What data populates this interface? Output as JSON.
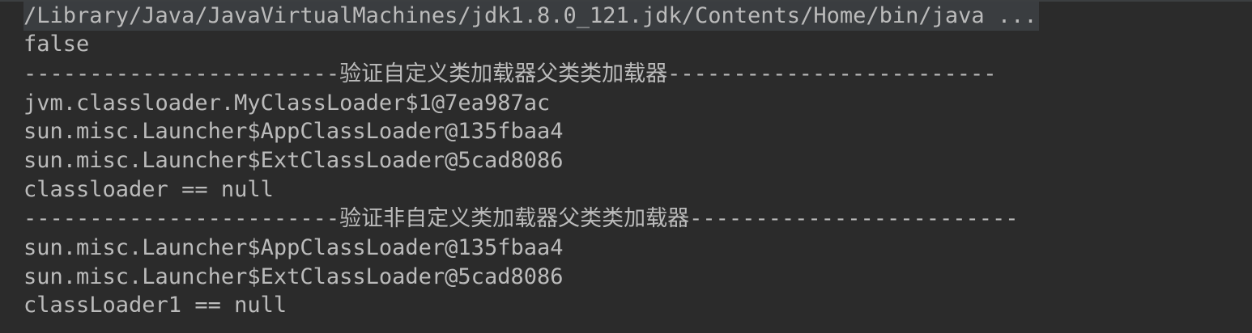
{
  "console": {
    "lines": [
      "/Library/Java/JavaVirtualMachines/jdk1.8.0_121.jdk/Contents/Home/bin/java ...",
      "false",
      "------------------------验证自定义类加载器父类类加载器-------------------------",
      "jvm.classloader.MyClassLoader$1@7ea987ac",
      "sun.misc.Launcher$AppClassLoader@135fbaa4",
      "sun.misc.Launcher$ExtClassLoader@5cad8086",
      "classloader == null",
      "------------------------验证非自定义类加载器父类类加载器-------------------------",
      "sun.misc.Launcher$AppClassLoader@135fbaa4",
      "sun.misc.Launcher$ExtClassLoader@5cad8086",
      "classLoader1 == null"
    ]
  },
  "colors": {
    "background": "#2b2b2b",
    "text": "#bbbbbb",
    "command_highlight": "#3a3d40"
  }
}
